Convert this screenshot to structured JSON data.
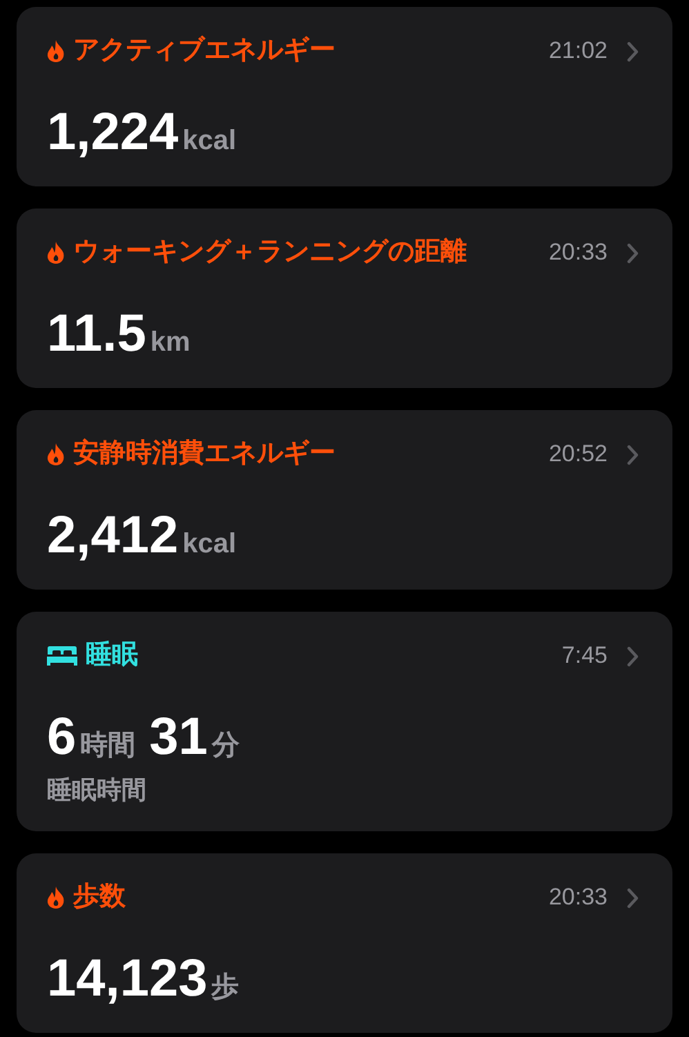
{
  "cards": [
    {
      "kind": "flame",
      "color": "#ff4f0a",
      "title": "アクティブエネルギー",
      "time": "21:02",
      "readings": [
        {
          "number": "1,224",
          "unit": "kcal"
        }
      ]
    },
    {
      "kind": "flame",
      "color": "#ff4f0a",
      "title": "ウォーキング＋ランニングの距離",
      "time": "20:33",
      "readings": [
        {
          "number": "11.5",
          "unit": "km"
        }
      ]
    },
    {
      "kind": "flame",
      "color": "#ff4f0a",
      "title": "安静時消費エネルギー",
      "time": "20:52",
      "readings": [
        {
          "number": "2,412",
          "unit": "kcal"
        }
      ]
    },
    {
      "kind": "bed",
      "color": "#32e0e0",
      "title": "睡眠",
      "time": "7:45",
      "readings": [
        {
          "number": "6",
          "unit": "時間"
        },
        {
          "number": "31",
          "unit": "分"
        }
      ],
      "caption": "睡眠時間"
    },
    {
      "kind": "flame",
      "color": "#ff4f0a",
      "title": "歩数",
      "time": "20:33",
      "readings": [
        {
          "number": "14,123",
          "unit": "歩"
        }
      ]
    }
  ]
}
